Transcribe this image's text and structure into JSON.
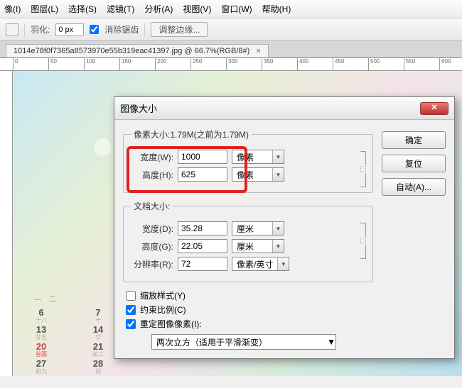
{
  "menu": [
    "像(I)",
    "图层(L)",
    "选择(S)",
    "滤镜(T)",
    "分析(A)",
    "视图(V)",
    "窗口(W)",
    "帮助(H)"
  ],
  "toolbar": {
    "feather_label": "羽化:",
    "feather_value": "0 px",
    "antialias_label": "消除锯齿",
    "adjust_edge": "调整边缘..."
  },
  "tab": {
    "title": "1014e78f0f7365a8573970e55b319eac41397.jpg @ 66.7%(RGB/8#)"
  },
  "ruler": {
    "marks": [
      "0",
      "50",
      "100",
      "150",
      "200",
      "250",
      "300",
      "350",
      "400",
      "450",
      "500",
      "550",
      "600"
    ]
  },
  "calendar": {
    "header": "— 二",
    "rows": [
      [
        {
          "d": "6",
          "s": "十八"
        },
        {
          "d": "7",
          "s": "十"
        }
      ],
      [
        {
          "d": "13",
          "s": "廿五"
        },
        {
          "d": "14",
          "s": "廿"
        }
      ],
      [
        {
          "d": "20",
          "s": "谷雨",
          "red": true
        },
        {
          "d": "21",
          "s": "初二"
        }
      ],
      [
        {
          "d": "27",
          "s": "初九"
        },
        {
          "d": "28",
          "s": "初"
        }
      ]
    ]
  },
  "dialog": {
    "title": "图像大小",
    "buttons": {
      "ok": "确定",
      "reset": "复位",
      "auto": "自动(A)..."
    },
    "pixel": {
      "legend": "像素大小:1.79M(之前为1.79M)",
      "width_label": "宽度(W):",
      "width_value": "1000",
      "height_label": "高度(H):",
      "height_value": "625",
      "unit": "像素"
    },
    "doc": {
      "legend": "文档大小:",
      "width_label": "宽度(D):",
      "width_value": "35.28",
      "height_label": "高度(G):",
      "height_value": "22.05",
      "unit": "厘米",
      "res_label": "分辨率(R):",
      "res_value": "72",
      "res_unit": "像素/英寸"
    },
    "checks": {
      "scale_styles": "缩放样式(Y)",
      "constrain": "约束比例(C)",
      "resample": "重定图像像素(I):"
    },
    "resample_method": "两次立方（适用于平滑渐变）"
  }
}
